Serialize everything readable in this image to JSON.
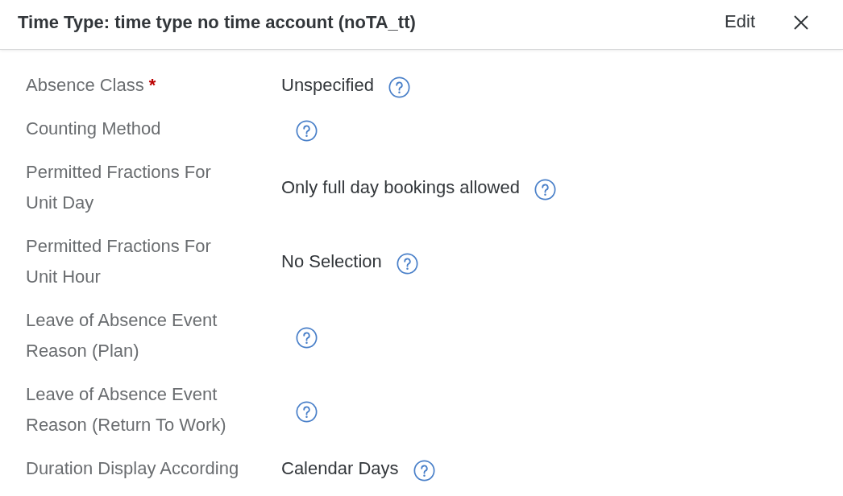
{
  "dialog": {
    "title": "Time Type: time type no time account (noTA_tt)",
    "actions": [
      {
        "kind": "edit",
        "label": "Edit"
      },
      {
        "kind": "close"
      }
    ]
  },
  "fields": [
    {
      "label": "Absence Class",
      "required_mark": "*",
      "value": "Unspecified",
      "help": true
    },
    {
      "label": "Counting Method",
      "help": true
    },
    {
      "label": "Permitted Fractions For Unit Day",
      "value": "Only full day bookings allowed",
      "help": true
    },
    {
      "label": "Permitted Fractions For Unit Hour",
      "value": "No Selection",
      "help": true
    },
    {
      "label": "Leave of Absence Event Reason (Plan)",
      "help": true
    },
    {
      "label": "Leave of Absence Event Reason (Return To Work)",
      "help": true
    },
    {
      "label": "Duration Display According",
      "value": "Calendar Days",
      "help": true
    }
  ]
}
